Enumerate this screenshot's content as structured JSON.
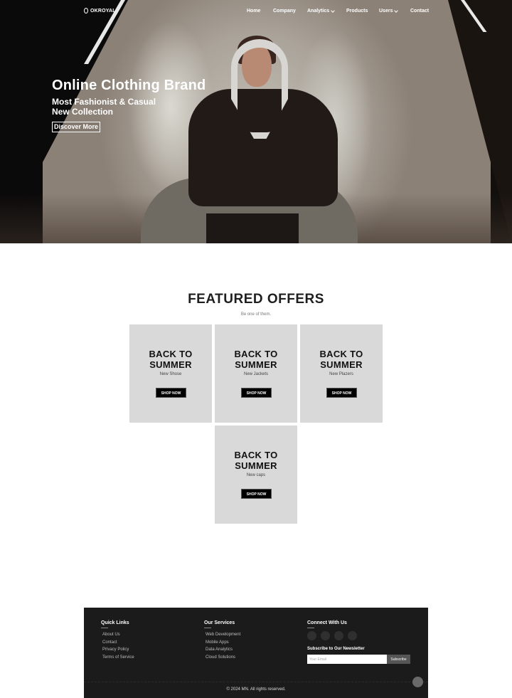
{
  "brand": {
    "name": "OKROYAL"
  },
  "nav": {
    "items": [
      {
        "label": "Home",
        "has_dropdown": false
      },
      {
        "label": "Company",
        "has_dropdown": false
      },
      {
        "label": "Analytics",
        "has_dropdown": true
      },
      {
        "label": "Products",
        "has_dropdown": false
      },
      {
        "label": "Users",
        "has_dropdown": true
      },
      {
        "label": "Contact",
        "has_dropdown": false
      }
    ]
  },
  "hero": {
    "title": "Online Clothing Brand",
    "subtitle_line1": "Most Fashionist & Casual",
    "subtitle_line2": "New Collection",
    "cta_label": "Discover More"
  },
  "featured": {
    "title": "FEATURED OFFERS",
    "subtitle": "Be one of them.",
    "cards": [
      {
        "title_line1": "BACK TO",
        "title_line2": "SUMMER",
        "subtitle": "New Shose",
        "button": "SHOP NOW"
      },
      {
        "title_line1": "BACK TO",
        "title_line2": "SUMMER",
        "subtitle": "New Jackets",
        "button": "SHOP NOW"
      },
      {
        "title_line1": "BACK TO",
        "title_line2": "SUMMER",
        "subtitle": "New Plazers",
        "button": "SHOP NOW"
      },
      {
        "title_line1": "BACK TO",
        "title_line2": "SUMMER",
        "subtitle": "New caps",
        "button": "SHOP NOW"
      }
    ]
  },
  "footer": {
    "quick_links": {
      "heading": "Quick Links",
      "items": [
        "About Us",
        "Contact",
        "Privacy Policy",
        "Terms of Service"
      ]
    },
    "services": {
      "heading": "Our Services",
      "items": [
        "Web Development",
        "Mobile Apps",
        "Data Analytics",
        "Cloud Solutions"
      ]
    },
    "connect": {
      "heading": "Connect With Us",
      "social_icons": [
        "social-icon-1",
        "social-icon-2",
        "social-icon-3",
        "social-icon-4"
      ],
      "newsletter_title": "Subscribe to Our Newsletter",
      "email_placeholder": "Your Email",
      "subscribe_label": "Subscribe"
    },
    "copyright": "© 2024 MN. All rights reserved."
  },
  "colors": {
    "footer_bg": "#1b1b1b",
    "card_bg": "#d9d9d9",
    "button_bg": "#000000",
    "subscribe_bg": "#555555"
  }
}
